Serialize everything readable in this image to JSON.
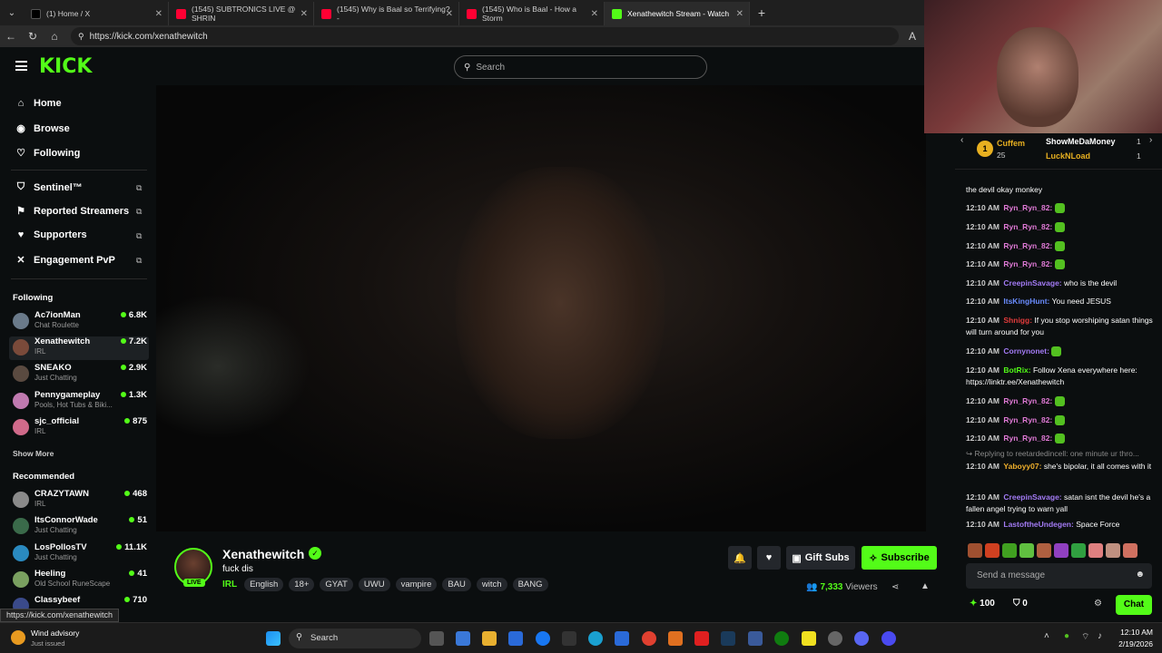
{
  "browser": {
    "tabs": [
      {
        "label": "(1) Home / X",
        "color": "#000000"
      },
      {
        "label": "(1545) SUBTRONICS LIVE @ SHRIN",
        "color": "#ff0033"
      },
      {
        "label": "(1545) Why is Baal so Terrifying? -",
        "color": "#ff0033"
      },
      {
        "label": "(1545) Who is Baal - How a Storm",
        "color": "#ff0033"
      },
      {
        "label": "Xenathewitch Stream - Watch",
        "color": "#53fc18"
      }
    ],
    "url": "https://kick.com/xenathewitch",
    "status_url": "https://kick.com/xenathewitch"
  },
  "header": {
    "logo": "KICK",
    "search_placeholder": "Search"
  },
  "sidebar": {
    "nav": [
      {
        "label": "Home",
        "icon": "⌂"
      },
      {
        "label": "Browse",
        "icon": "◉"
      },
      {
        "label": "Following",
        "icon": "♡"
      }
    ],
    "tools": [
      {
        "label": "Sentinel™",
        "icon": "⛉"
      },
      {
        "label": "Reported Streamers",
        "icon": "⚑"
      },
      {
        "label": "Supporters",
        "icon": "♥"
      },
      {
        "label": "Engagement PvP",
        "icon": "✕"
      }
    ],
    "following_title": "Following",
    "following": [
      {
        "name": "Ac7ionMan",
        "category": "Chat Roulette",
        "viewers": "6.8K"
      },
      {
        "name": "Xenathewitch",
        "category": "IRL",
        "viewers": "7.2K"
      },
      {
        "name": "SNEAKO",
        "category": "Just Chatting",
        "viewers": "2.9K"
      },
      {
        "name": "Pennygameplay",
        "category": "Pools, Hot Tubs & Biki...",
        "viewers": "1.3K"
      },
      {
        "name": "sjc_official",
        "category": "IRL",
        "viewers": "875"
      }
    ],
    "show_more": "Show More",
    "recommended_title": "Recommended",
    "recommended": [
      {
        "name": "CRAZYTAWN",
        "category": "IRL",
        "viewers": "468"
      },
      {
        "name": "ItsConnorWade",
        "category": "Just Chatting",
        "viewers": "51"
      },
      {
        "name": "LosPollosTV",
        "category": "Just Chatting",
        "viewers": "11.1K"
      },
      {
        "name": "Heeling",
        "category": "Old School RuneScape",
        "viewers": "41"
      },
      {
        "name": "Classybeef",
        "category": "",
        "viewers": "710"
      }
    ]
  },
  "stream": {
    "name": "Xenathewitch",
    "title": "fuck dis",
    "live": "LIVE",
    "category": "IRL",
    "tags": [
      "English",
      "18+",
      "GYAT",
      "UWU",
      "vampire",
      "BAU",
      "witch",
      "BANG"
    ],
    "gift_subs": "Gift Subs",
    "subscribe": "Subscribe",
    "viewers_count": "7,333",
    "viewers_label": "Viewers"
  },
  "chat": {
    "pinned": {
      "user1": "Cuffem",
      "rank1": "1",
      "count1": "25",
      "user2": "ShowMeDaMoney",
      "count2": "1",
      "user3": "LuckNLoad",
      "count3": "1"
    },
    "messages": [
      {
        "time": "",
        "user": "",
        "color": "#ffffff",
        "text": "the devil okay monkey",
        "emote": false
      },
      {
        "time": "12:10 AM",
        "user": "Ryn_Ryn_82:",
        "color": "#e07ad6",
        "text": "",
        "emote": true
      },
      {
        "time": "12:10 AM",
        "user": "Ryn_Ryn_82:",
        "color": "#e07ad6",
        "text": "",
        "emote": true
      },
      {
        "time": "12:10 AM",
        "user": "Ryn_Ryn_82:",
        "color": "#e07ad6",
        "text": "",
        "emote": true
      },
      {
        "time": "12:10 AM",
        "user": "Ryn_Ryn_82:",
        "color": "#e07ad6",
        "text": "",
        "emote": true
      },
      {
        "time": "12:10 AM",
        "user": "CreepinSavage:",
        "color": "#a37bf5",
        "text": " who is the devil",
        "emote": false
      },
      {
        "time": "12:10 AM",
        "user": "ItsKingHunt:",
        "color": "#6a8cff",
        "text": " You need JESUS",
        "emote": false
      },
      {
        "time": "12:10 AM",
        "user": "Shnigg:",
        "color": "#e23b3b",
        "text": " If you stop worshiping satan things will turn around for you",
        "emote": false
      },
      {
        "time": "12:10 AM",
        "user": "Cornynonet:",
        "color": "#a37bf5",
        "text": "",
        "emote": true
      },
      {
        "time": "12:10 AM",
        "user": "BotRix:",
        "color": "#53fc18",
        "text": " Follow Xena everywhere here: https://linktr.ee/Xenathewitch",
        "emote": false
      },
      {
        "time": "12:10 AM",
        "user": "Ryn_Ryn_82:",
        "color": "#e07ad6",
        "text": "",
        "emote": true
      },
      {
        "time": "12:10 AM",
        "user": "Ryn_Ryn_82:",
        "color": "#e07ad6",
        "text": "",
        "emote": true
      },
      {
        "time": "12:10 AM",
        "user": "Ryn_Ryn_82:",
        "color": "#e07ad6",
        "text": "",
        "emote": true
      },
      {
        "time": "",
        "user": "",
        "color": "#888888",
        "text": "↪ Replying to reetardedincell: one minute ur thro...",
        "emote": false
      },
      {
        "time": "12:10 AM",
        "user": "Yaboyy07:",
        "color": "#f0b02c",
        "text": " she's bipolar, it all comes with it",
        "emote": false
      },
      {
        "time": "12:10 AM",
        "user": "CreepinSavage:",
        "color": "#a37bf5",
        "text": " satan isnt the devil he's a fallen angel trying to warn yall",
        "emote": false
      },
      {
        "time": "12:10 AM",
        "user": "LastoftheUndegen:",
        "color": "#a37bf5",
        "text": " Space Force",
        "emote": false
      }
    ],
    "input_placeholder": "Send a message",
    "points": "100",
    "badge_count": "0",
    "send_label": "Chat"
  },
  "taskbar": {
    "weather_title": "Wind advisory",
    "weather_sub": "Just issued",
    "search": "Search",
    "time": "12:10 AM",
    "date": "2/19/2026"
  }
}
